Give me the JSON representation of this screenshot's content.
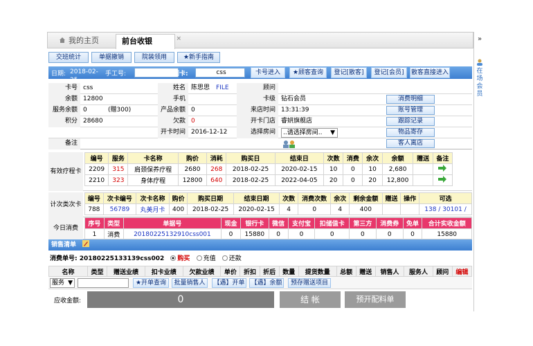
{
  "tabs": {
    "home": "我的主页",
    "active": "前台收银",
    "close": "×"
  },
  "right_rail": {
    "label": "在场会员",
    "chevron": "»"
  },
  "toolbar": [
    "交班统计",
    "单据撤销",
    "院装领用",
    "★新手指南"
  ],
  "datebar": {
    "date_label": "日期:",
    "date": "2018-02-25",
    "worker_label": "手工号:",
    "worker": "",
    "card_label": "刷卡:",
    "card": "css",
    "buttons": [
      "卡号进入",
      "★顾客查询",
      "登记[散客]",
      "登记[会员]",
      "散客直接进入"
    ]
  },
  "info": {
    "card_no_label": "卡号",
    "card_no": "css",
    "name_label": "姓名",
    "name": "陈思思",
    "file": "FILE",
    "consultant_label": "顾问",
    "consultant": "",
    "balance_label": "余额",
    "balance": "12800",
    "phone_label": "手机",
    "phone": "",
    "level_label": "卡级",
    "level": "钻石会员",
    "btn_detail": "消费明细",
    "svc_balance_label": "服务余额",
    "svc_balance": "0",
    "svc_gift": "(赠300)",
    "prod_balance_label": "产品余额",
    "prod_balance": "0",
    "visit_time_label": "来店时间",
    "visit_time": "13:31:39",
    "btn_account": "账号管理",
    "points_label": "积分",
    "points": "28680",
    "debt_label": "欠款",
    "debt": "0",
    "shop_label": "开卡门店",
    "shop": "睿妍旗舰店",
    "btn_follow": "跟踪记录",
    "open_time_label": "开卡时间",
    "open_time": "2016-12-12",
    "room_label": "选择房间",
    "room": "..请选择房间..",
    "btn_store": "物品寄存",
    "note_label": "备注",
    "note": "",
    "btn_leave": "客人离店"
  },
  "course_cards": {
    "label": "有效疗程卡",
    "headers": [
      "编号",
      "服务",
      "卡名称",
      "购价",
      "消耗",
      "购买日",
      "结束日",
      "次数",
      "消费",
      "余次",
      "余额",
      "赠送",
      "备注"
    ],
    "rows": [
      [
        "2209",
        "315",
        "肩颈保养疗程",
        "2680",
        "268",
        "2018-02-25",
        "2020-02-15",
        "10",
        "0",
        "10",
        "2,680",
        "",
        ""
      ],
      [
        "2210",
        "323",
        "身体疗程",
        "12800",
        "640",
        "2018-02-25",
        "2022-04-05",
        "20",
        "0",
        "20",
        "12,800",
        "",
        ""
      ]
    ]
  },
  "count_cards": {
    "label": "计次类次卡",
    "headers": [
      "编号",
      "次卡编号",
      "次卡名称",
      "购价",
      "购买日期",
      "结束日期",
      "次数",
      "消费次数",
      "余次",
      "剩余金额",
      "赠送",
      "操作",
      "可选"
    ],
    "row": [
      "788",
      "56789",
      "丸美月卡",
      "400",
      "2018-02-25",
      "2020-02-15",
      "4",
      "0",
      "4",
      "400",
      "",
      "",
      "138 / 30101 /"
    ]
  },
  "today": {
    "label": "今日消费",
    "headers": [
      "序号",
      "类型",
      "单据号",
      "现金",
      "银行卡",
      "微信",
      "支付宝",
      "扣储值卡",
      "第三方",
      "消费券",
      "免单",
      "合计实收金额"
    ],
    "row": [
      "1",
      "消费",
      "20180225132910css001",
      "0",
      "15880",
      "0",
      "0",
      "0",
      "0",
      "0",
      "0",
      "15880"
    ]
  },
  "sales": {
    "title": "销售清单",
    "order_label": "消费单号:",
    "order_no": "20180225133139css002",
    "radio_buy": "购买",
    "radio_refill": "充值",
    "radio_return": "还款",
    "headers": [
      "名称",
      "类型",
      "赠送业绩",
      "扣卡业绩",
      "欠款业绩",
      "单价",
      "折扣",
      "折后",
      "数量",
      "提货数量",
      "总额",
      "赠送",
      "销售人",
      "服务人",
      "顾问",
      "编辑"
    ],
    "type_select": "服务",
    "buttons": [
      "★开单查询",
      "批量销售人",
      "【遇】开单",
      "【遇】余额",
      "预存赠送项目"
    ],
    "total_label": "应收金额:",
    "total": "0",
    "checkout": "结 帐",
    "prefill": "预开配料单"
  }
}
